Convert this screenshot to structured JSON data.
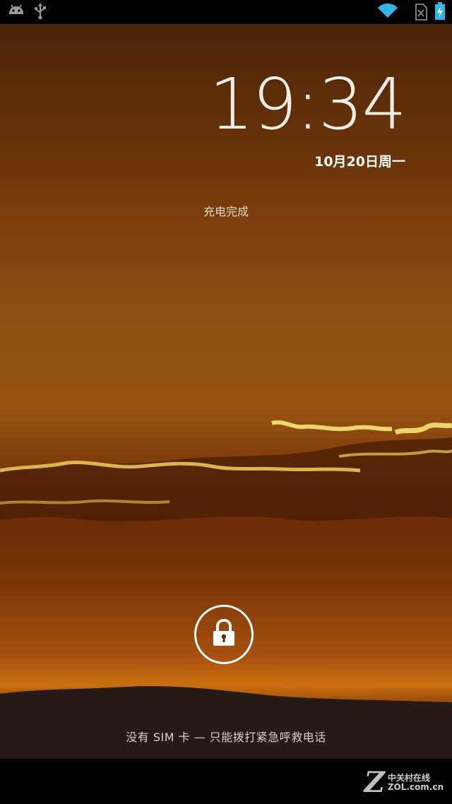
{
  "status_bar": {
    "left_icons": [
      "android-debug-icon",
      "usb-icon"
    ],
    "right_icons": [
      "wifi-icon",
      "no-sim-icon",
      "battery-charging-icon"
    ]
  },
  "lockscreen": {
    "time": "19:34",
    "date": "10月20日周一",
    "charge_status": "充电完成",
    "sim_message": "没有 SIM 卡 — 只能拨打紧急呼救电话",
    "unlock_icon": "lock-icon"
  },
  "watermark": {
    "logo": "Z",
    "cn": "中关村在线",
    "en": "ZOL.com.cn"
  },
  "colors": {
    "accent_wifi": "#33b5e5",
    "battery": "#33b5e5"
  }
}
